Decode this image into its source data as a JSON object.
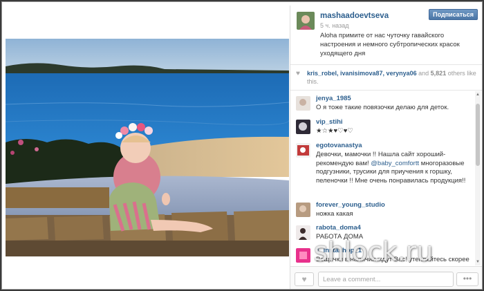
{
  "post": {
    "username": "mashaadoevtseva",
    "follow_label": "Подписаться",
    "timestamp": "5 ч. назад",
    "caption": "Aloha    примите от нас чуточку гавайского настроения и немного субтропических красок уходящего дня",
    "likes": {
      "likers": "kris_robel, ivanisimova87, verynya06",
      "and_label": "and",
      "count": "5,821",
      "suffix": "others like this."
    }
  },
  "comments": [
    {
      "username": "jenya_1985",
      "text": "О я тоже такие повязочки делаю для деток."
    },
    {
      "username": "vip_stihi",
      "text": "★☆★♥♡♥♡"
    },
    {
      "username": "egotovanastya",
      "text_before": "Девочки, мамочки    !! Нашла сайт хороший-рекомендую вам! ",
      "mention": "@baby_comfortt",
      "text_after": " многоразовые подгузники, трусики для приучения к горшку, пеленочки    !! Мне очень понравилась продукция!!"
    },
    {
      "username": "forever_young_studio",
      "text": "   ножка какая"
    },
    {
      "username": "rabota_doma4",
      "text": "РАБОТА ДОМА"
    },
    {
      "username": "1_instashop_1",
      "text": "   Вещички в наличии ждут Вас!    утепляйтесь скорее"
    }
  ],
  "footer": {
    "comment_placeholder": "Leave a comment...",
    "more_label": "•••"
  },
  "watermark": "shlock.ru",
  "colors": {
    "accent": "#2d5f8e",
    "follow_button": "#5a86b6"
  }
}
